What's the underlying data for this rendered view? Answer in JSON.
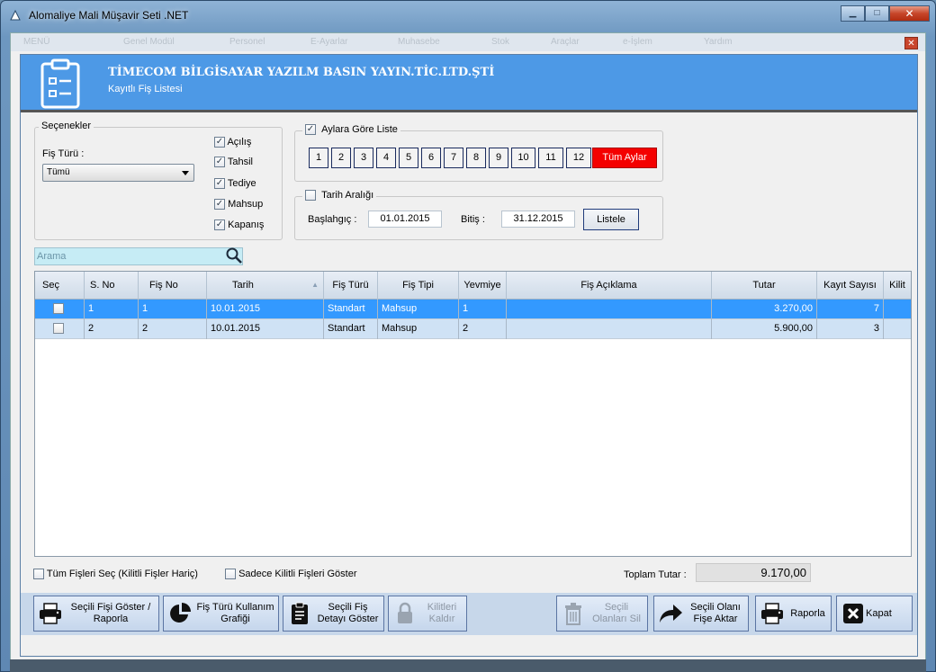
{
  "window": {
    "title": "Alomaliye Mali Müşavir Seti .NET",
    "minimize": "▁",
    "maximize": "□",
    "close": "✕"
  },
  "menubar": {
    "items": [
      "MENÜ",
      "Genel Modül",
      "Personel",
      "E-Ayarlar",
      "Muhasebe",
      "Stok",
      "Araçlar",
      "e-İşlem",
      "Yardım"
    ]
  },
  "header": {
    "company": "TİMECOM BİLGİSAYAR YAZILM BASIN YAYIN.TİC.LTD.ŞTİ",
    "subtitle": "Kayıtlı Fiş Listesi"
  },
  "options": {
    "legend": "Seçenekler",
    "fis_turu_label": "Fiş Türü :",
    "fis_turu_value": "Tümü",
    "checks": [
      {
        "label": "Açılış",
        "checked": true
      },
      {
        "label": "Tahsil",
        "checked": true
      },
      {
        "label": "Tediye",
        "checked": true
      },
      {
        "label": "Mahsup",
        "checked": true
      },
      {
        "label": "Kapanış",
        "checked": true
      }
    ]
  },
  "months": {
    "label": "Aylara Göre Liste",
    "checked": true,
    "buttons": [
      "1",
      "2",
      "3",
      "4",
      "5",
      "6",
      "7",
      "8",
      "9",
      "10",
      "11",
      "12"
    ],
    "all": "Tüm Aylar"
  },
  "range": {
    "label": "Tarih Aralığı",
    "checked": false,
    "start_label": "Başlahgıç  :",
    "start": "01.01.2015",
    "end_label": "Bitiş   :",
    "end": "31.12.2015",
    "list_button": "Listele"
  },
  "search": {
    "placeholder": "Arama"
  },
  "grid": {
    "columns": [
      "Seç",
      "S. No",
      "Fiş No",
      "Tarih",
      "Fiş Türü",
      "Fiş Tipi",
      "Yevmiye",
      "Fiş Açıklama",
      "Tutar",
      "Kayıt Sayısı",
      "Kilit"
    ],
    "sort_indicator": "▲",
    "rows": [
      {
        "sec": false,
        "sno": "1",
        "fisno": "1",
        "tarih": "10.01.2015",
        "tur": "Standart",
        "tip": "Mahsup",
        "yevmiye": "1",
        "aciklama": "",
        "tutar": "3.270,00",
        "kayit": "7",
        "kilit": ""
      },
      {
        "sec": false,
        "sno": "2",
        "fisno": "2",
        "tarih": "10.01.2015",
        "tur": "Standart",
        "tip": "Mahsup",
        "yevmiye": "2",
        "aciklama": "",
        "tutar": "5.900,00",
        "kayit": "3",
        "kilit": ""
      }
    ]
  },
  "footer": {
    "select_all": "Tüm Fişleri Seç (Kilitli Fişler Hariç)",
    "only_locked": "Sadece Kilitli Fişleri Göster",
    "total_label": "Toplam Tutar :",
    "total": "9.170,00"
  },
  "buttons": {
    "show_report": [
      "Seçili Fişi Göster /",
      "Raporla"
    ],
    "chart": [
      "Fiş Türü Kullanım",
      "Grafiği"
    ],
    "detail": [
      "Seçili Fiş",
      "Detayı Göster"
    ],
    "unlock": [
      "Kilitleri",
      "Kaldır"
    ],
    "delete": [
      "Seçili",
      "Olanları Sil"
    ],
    "transfer": [
      "Seçili Olanı",
      "Fişe Aktar"
    ],
    "report": "Raporla",
    "close": "Kapat"
  }
}
